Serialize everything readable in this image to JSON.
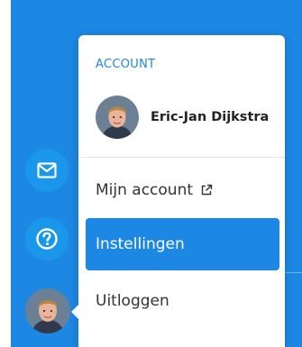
{
  "colors": {
    "brand_blue": "#1d87e4",
    "rail_button": "#1a96ea",
    "menu_background": "#ffffff",
    "text_dark": "#222222"
  },
  "rail": {
    "icons": [
      "mail-icon",
      "help-icon",
      "user-avatar"
    ]
  },
  "menu": {
    "section_label": "ACCOUNT",
    "user_name": "Eric-Jan Dijkstra",
    "items": [
      {
        "label": "Mijn account",
        "icon": "external-link-icon",
        "active": false
      },
      {
        "label": "Instellingen",
        "active": true
      },
      {
        "label": "Uitloggen",
        "active": false
      }
    ]
  }
}
